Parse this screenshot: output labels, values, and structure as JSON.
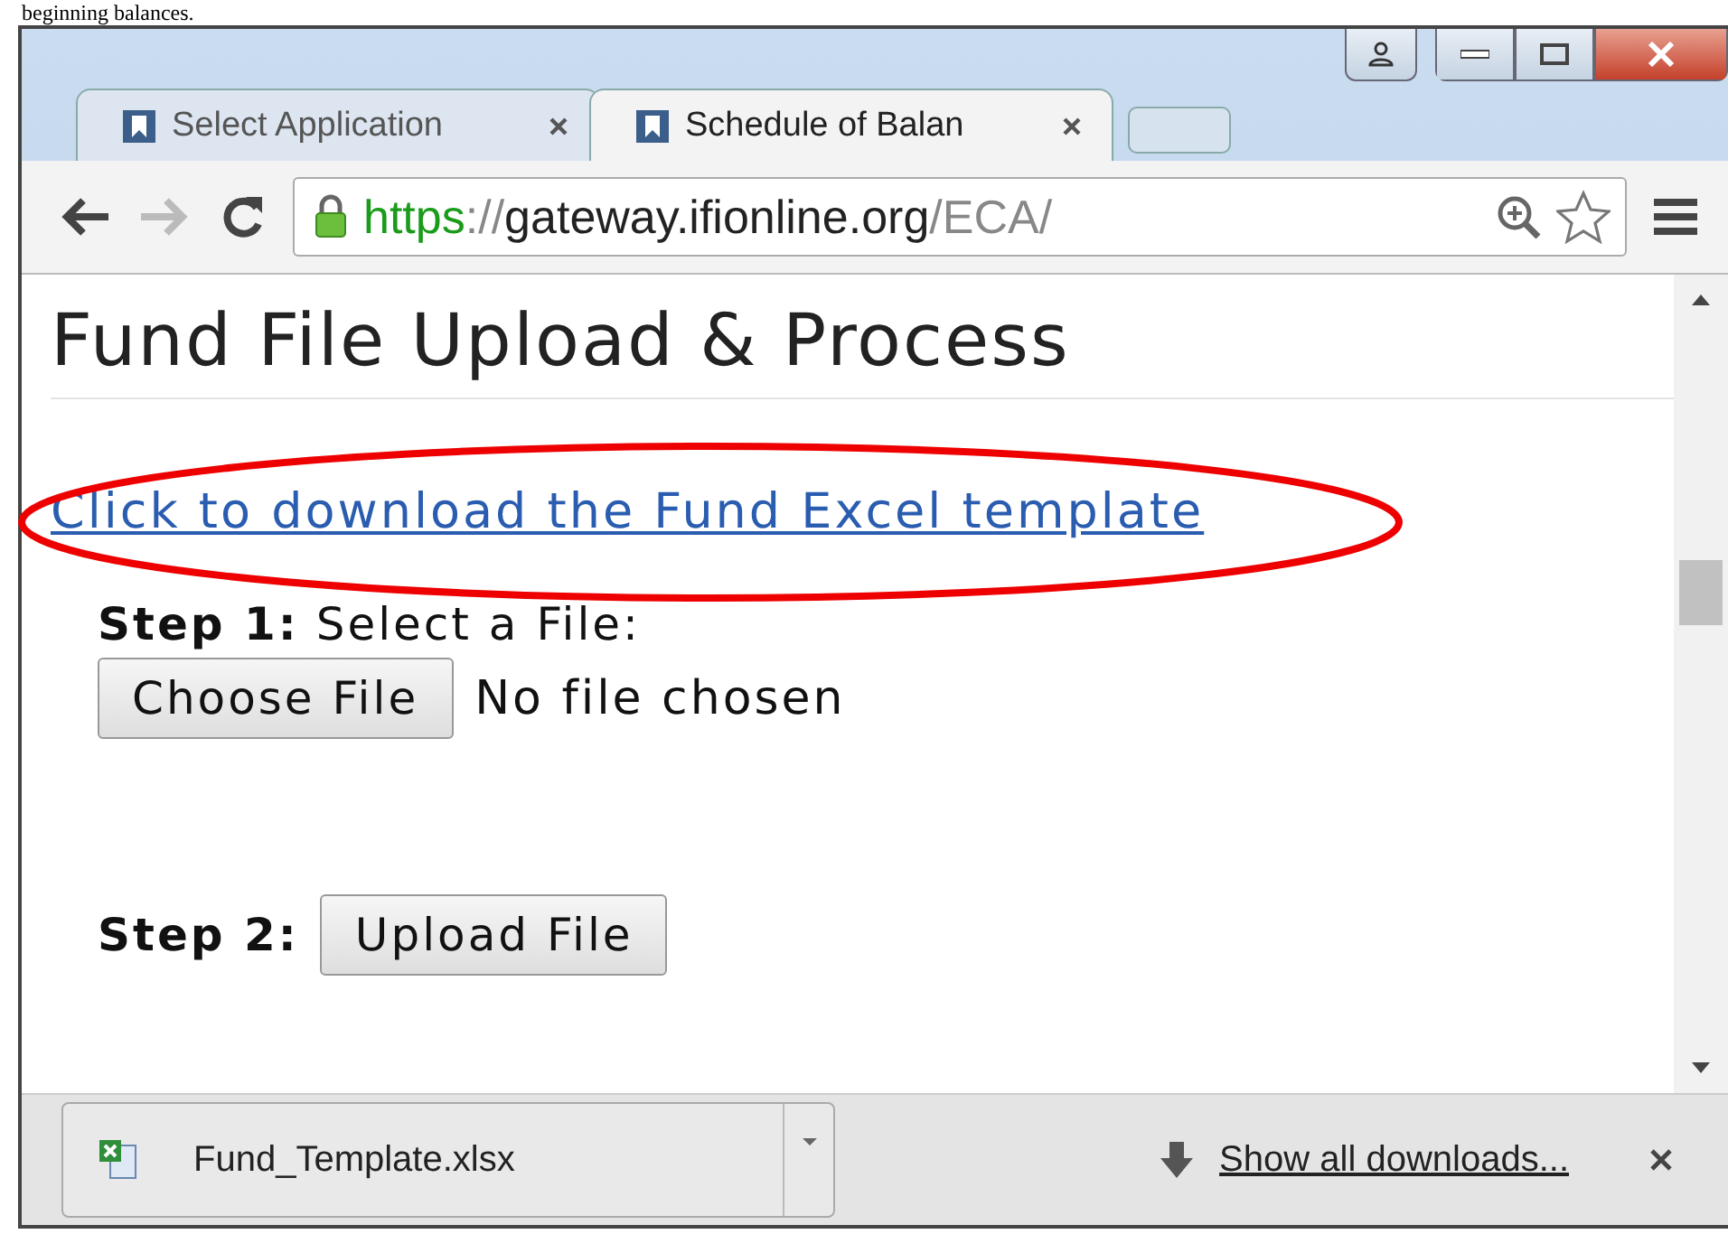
{
  "document_text": "beginning balances.",
  "tabs": [
    {
      "title": "Select Application",
      "selected": false
    },
    {
      "title": "Schedule of Balan",
      "selected": true
    }
  ],
  "address_bar": {
    "scheme": "https",
    "separator": "://",
    "host": "gateway.ifionline.org",
    "path": "/ECA/"
  },
  "page": {
    "heading": "Fund File Upload & Process",
    "download_link": "Click to download the Fund Excel template",
    "step1": {
      "label": "Step 1:",
      "text": "Select a File:",
      "button": "Choose File",
      "status": "No file chosen"
    },
    "step2": {
      "label": "Step 2:",
      "button": "Upload File"
    }
  },
  "downloads_bar": {
    "file": "Fund_Template.xlsx",
    "show_all": "Show all downloads..."
  }
}
